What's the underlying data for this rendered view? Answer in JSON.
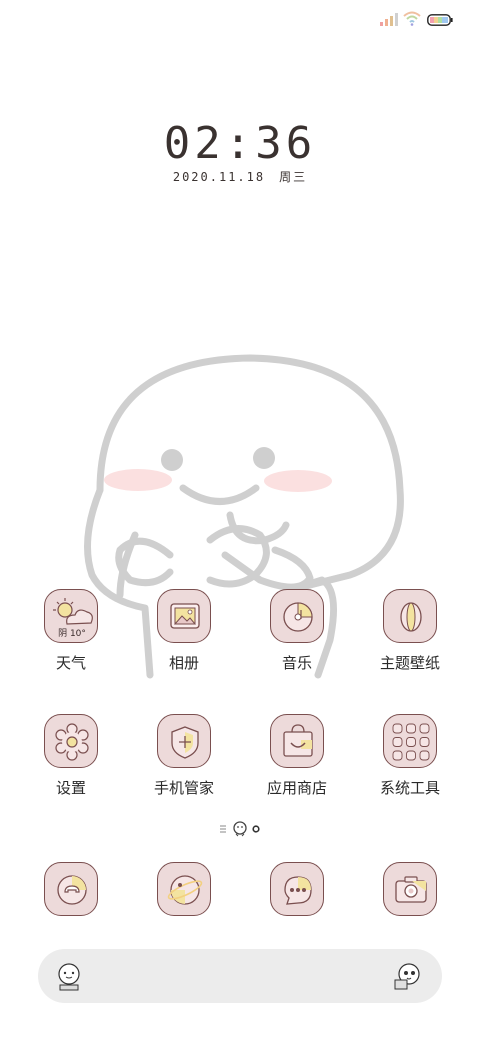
{
  "status_bar": {
    "signal_icon": "signal-bars",
    "wifi_icon": "wifi",
    "battery_icon": "battery"
  },
  "lock": {
    "time": "02:36",
    "date": "2020.11.18",
    "weekday": "周三"
  },
  "apps": [
    {
      "label": "天气",
      "icon": "weather-icon",
      "icon_text": "阴 10°"
    },
    {
      "label": "相册",
      "icon": "gallery-icon"
    },
    {
      "label": "音乐",
      "icon": "music-icon"
    },
    {
      "label": "主题壁纸",
      "icon": "theme-icon"
    },
    {
      "label": "设置",
      "icon": "settings-icon"
    },
    {
      "label": "手机管家",
      "icon": "security-icon"
    },
    {
      "label": "应用商店",
      "icon": "app-store-icon"
    },
    {
      "label": "系统工具",
      "icon": "system-tools-folder-icon"
    }
  ],
  "dock": [
    {
      "icon": "phone-icon"
    },
    {
      "icon": "browser-icon"
    },
    {
      "icon": "messages-icon"
    },
    {
      "icon": "camera-icon"
    }
  ],
  "colors": {
    "icon_bg": "#eddada",
    "icon_border": "#7a4f4f",
    "accent_yellow": "#f3e3a0",
    "searchbar_bg": "#ececec"
  }
}
